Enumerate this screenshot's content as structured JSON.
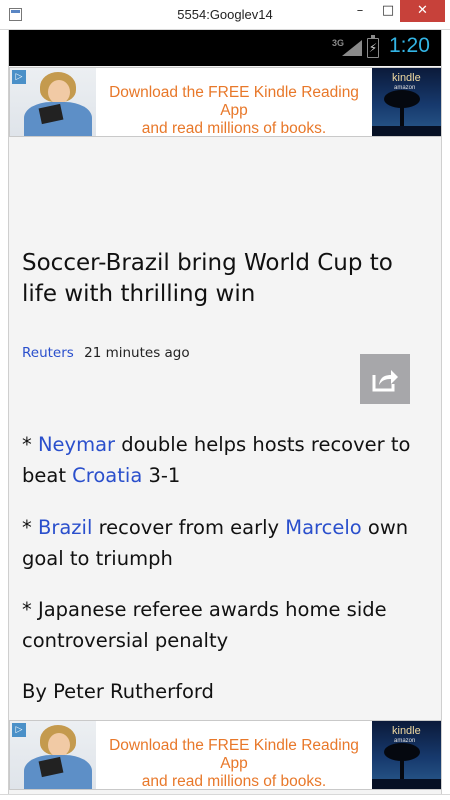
{
  "window": {
    "title": "5554:Googlev14",
    "minimize_glyph": "–",
    "maximize_glyph": "□",
    "close_glyph": "✕"
  },
  "statusbar": {
    "network": "3G",
    "time": "1:20",
    "accent_color": "#33b5e5"
  },
  "ad": {
    "line1": "Download the FREE Kindle Reading App",
    "line2": "and read millions of books.",
    "brand": "kindle",
    "brand_sub": "amazon",
    "badge_icon": "ad-choices-icon",
    "text_color": "#e8782a"
  },
  "article": {
    "headline": "Soccer-Brazil bring World Cup to life with thrilling win",
    "source": "Reuters",
    "time_ago": "21 minutes ago",
    "share_icon": "share-icon",
    "link_color": "#2a4fcc",
    "paragraphs": {
      "p1": {
        "bullet": "* ",
        "link1": "Neymar",
        "text1": " double helps hosts recover to beat ",
        "link2": "Croatia",
        "text2": " 3-1"
      },
      "p2": {
        "bullet": "* ",
        "link1": "Brazil",
        "text1": " recover from early ",
        "link2": "Marcelo",
        "text2": " own goal to triumph"
      },
      "p3": {
        "text": "* Japanese referee awards home side controversial penalty"
      },
      "p4": {
        "text": "By Peter Rutherford"
      }
    }
  }
}
